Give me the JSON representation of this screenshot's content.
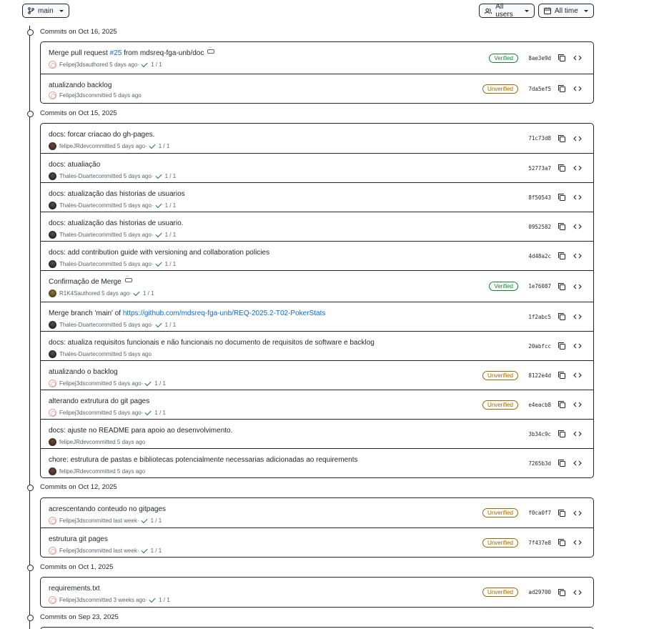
{
  "toolbar": {
    "branch_label": "main",
    "users_label": "All users",
    "time_label": "All time"
  },
  "groups": [
    {
      "date": "Commits on Oct 16, 2025",
      "commits": [
        {
          "message_pre": "Merge pull request ",
          "message_link": "#25",
          "message_post": " from mdsreq-fga-unb/doc",
          "has_ellipsis": true,
          "author": "Felipej3ds",
          "action": "authored 5 days ago",
          "checks": "1 / 1",
          "badge": "Verified",
          "sha": "8ae3e9d",
          "avatar": "felipej3ds"
        },
        {
          "message_pre": "atualizando backlog",
          "author": "Felipej3ds",
          "action": "committed 5 days ago",
          "badge": "Unverified",
          "sha": "7da5ef5",
          "avatar": "felipej3ds"
        }
      ]
    },
    {
      "date": "Commits on Oct 15, 2025",
      "commits": [
        {
          "message_pre": "docs: forcar criacao do gh-pages.",
          "author": "felipeJRdev",
          "action": "committed 5 days ago",
          "checks": "1 / 1",
          "sha": "71c73d8",
          "avatar": "felipejrdev"
        },
        {
          "message_pre": "docs: atualiação",
          "author": "Thales-Duarte",
          "action": "committed 5 days ago",
          "checks": "1 / 1",
          "sha": "52773a7",
          "avatar": "thales"
        },
        {
          "message_pre": "docs: atualização das historias de usuarios",
          "author": "Thales-Duarte",
          "action": "committed 5 days ago",
          "checks": "1 / 1",
          "sha": "8f50543",
          "avatar": "thales"
        },
        {
          "message_pre": "docs: atualização das historias de usuario.",
          "author": "Thales-Duarte",
          "action": "committed 5 days ago",
          "checks": "1 / 1",
          "sha": "0952582",
          "avatar": "thales"
        },
        {
          "message_pre": "docs: add contribution guide with versioning and collaboration policies",
          "author": "Thales-Duarte",
          "action": "committed 5 days ago",
          "checks": "1 / 1",
          "sha": "4d48a2c",
          "avatar": "thales"
        },
        {
          "message_pre": "Confirmação de Merge",
          "has_ellipsis": true,
          "author": "R1K4S",
          "action": "authored 5 days ago",
          "checks": "1 / 1",
          "badge": "Verified",
          "sha": "1e76087",
          "avatar": "r1k4s"
        },
        {
          "message_pre": "Merge branch 'main' of ",
          "message_link": "https://github.com/mdsreq-fga-unb/REQ-2025.2-T02-PokerStats",
          "author": "Thales-Duarte",
          "action": "committed 5 days ago",
          "checks": "1 / 1",
          "sha": "1f2abc5",
          "avatar": "thales"
        },
        {
          "message_pre": "docs: atualiza requisitos funcionais e não funcionais no documento de requisitos de software e backlog",
          "author": "Thales-Duarte",
          "action": "committed 5 days ago",
          "sha": "20abfcc",
          "avatar": "thales"
        },
        {
          "message_pre": "atualizando o backlog",
          "author": "Felipej3ds",
          "action": "committed 5 days ago",
          "checks": "1 / 1",
          "badge": "Unverified",
          "sha": "8122e4d",
          "avatar": "felipej3ds"
        },
        {
          "message_pre": "alterando extrutura do git pages",
          "author": "Felipej3ds",
          "action": "committed 5 days ago",
          "checks": "1 / 1",
          "badge": "Unverified",
          "sha": "e4eacb8",
          "avatar": "felipej3ds"
        },
        {
          "message_pre": "docs: ajuste no README para apoio ao desenvolvimento.",
          "author": "felipeJRdev",
          "action": "committed 5 days ago",
          "sha": "3b34c9c",
          "avatar": "felipejrdev"
        },
        {
          "message_pre": "chore: estrutura de pastas e bibliotecas potencialmente necessarias adicionadas ao requirements",
          "author": "felipeJRdev",
          "action": "committed 5 days ago",
          "sha": "7265b3d",
          "avatar": "felipejrdev"
        }
      ]
    },
    {
      "date": "Commits on Oct 12, 2025",
      "commits": [
        {
          "message_pre": "acrescentando conteudo no gitpages",
          "author": "Felipej3ds",
          "action": "committed last week",
          "checks": "1 / 1",
          "badge": "Unverified",
          "sha": "f0ca0f7",
          "avatar": "felipej3ds"
        },
        {
          "message_pre": "estrutura git pages",
          "author": "Felipej3ds",
          "action": "committed last week",
          "checks": "1 / 1",
          "badge": "Unverified",
          "sha": "7f437e8",
          "avatar": "felipej3ds"
        }
      ]
    },
    {
      "date": "Commits on Oct 1, 2025",
      "commits": [
        {
          "message_pre": "requirements.txt",
          "author": "Felipej3ds",
          "action": "committed 3 weeks ago",
          "checks": "1 / 1",
          "badge": "Unverified",
          "sha": "ad29700",
          "avatar": "felipej3ds"
        }
      ]
    },
    {
      "date": "Commits on Sep 23, 2025",
      "commits": []
    }
  ],
  "colors": {
    "verified": "#1a7f37",
    "unverified": "#9a6700",
    "link": "#0969da",
    "border": "#1f2328"
  }
}
